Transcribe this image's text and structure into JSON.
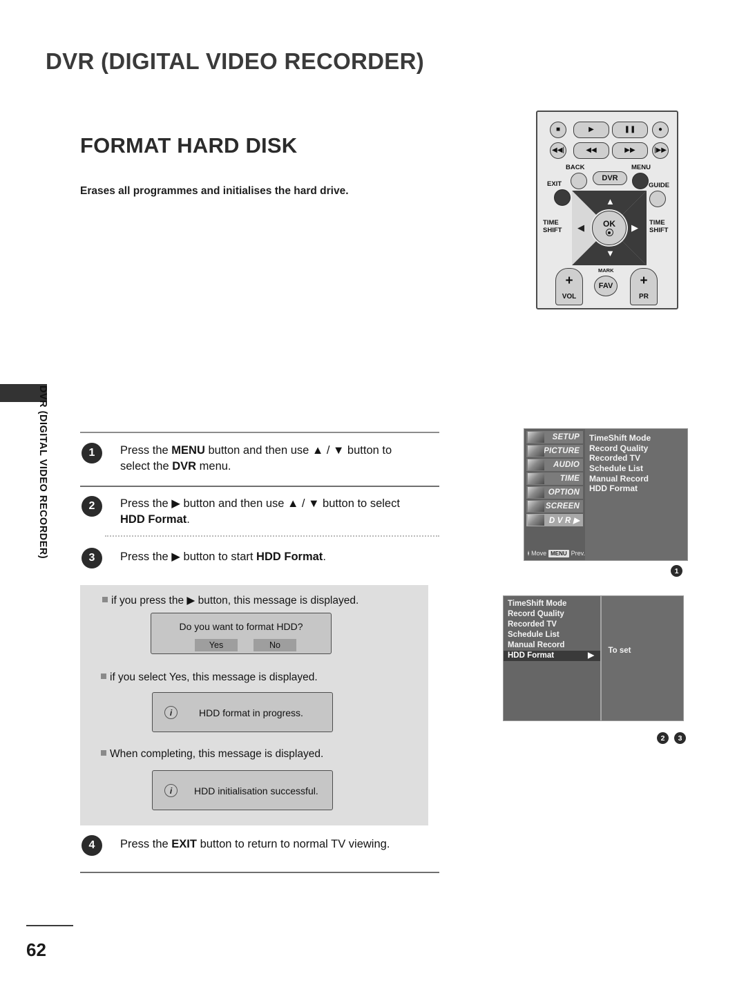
{
  "header": {
    "chapter_title": "DVR (DIGITAL VIDEO RECORDER)",
    "section_title": "FORMAT HARD DISK",
    "section_subtitle": "Erases all programmes and initialises the hard drive."
  },
  "sidebar": {
    "vertical_label": "DVR (DIGITAL VIDEO RECORDER)"
  },
  "remote": {
    "buttons": {
      "stop": "stop-icon",
      "play": "play-icon",
      "pause": "pause-icon",
      "record": "record-icon",
      "skip_back": "skip-back-icon",
      "rewind": "rewind-icon",
      "forward": "fast-forward-icon",
      "skip_forward": "skip-forward-icon"
    },
    "labels": {
      "back": "BACK",
      "dvr": "DVR",
      "menu": "MENU",
      "exit": "EXIT",
      "guide": "GUIDE",
      "time_shift_left_1": "TIME",
      "time_shift_left_2": "SHIFT",
      "time_shift_right_1": "TIME",
      "time_shift_right_2": "SHIFT",
      "ok": "OK",
      "vol_plus": "+",
      "vol": "VOL",
      "pr_plus": "+",
      "pr": "PR",
      "mark": "MARK",
      "fav": "FAV",
      "up_arrow": "▲",
      "down_arrow": "▼",
      "left_arrow": "◀",
      "right_arrow": "▶"
    }
  },
  "steps": [
    {
      "number": "1",
      "line1_a": "Press the ",
      "line1_b": "MENU",
      "line1_c": " button and  then use ▲ / ▼ button to",
      "line2_a": "select the ",
      "line2_b": "DVR",
      "line2_c": " menu."
    },
    {
      "number": "2",
      "line1_a": "Press the ▶ button and then use ▲ / ▼ button to select",
      "line2_b": "HDD Format",
      "line2_c": "."
    },
    {
      "number": "3",
      "line1_a": "Press the ▶ button to start ",
      "line1_b": "HDD Format",
      "line1_c": "."
    },
    {
      "number": "4",
      "line1_a": "Press the ",
      "line1_b": "EXIT",
      "line1_c": " button to return to normal TV viewing."
    }
  ],
  "notes": [
    "if you press the ▶ button, this message is displayed.",
    "if you select Yes, this message is displayed.",
    "When completing, this message is displayed."
  ],
  "dialogs": {
    "confirm": {
      "title": "Do you want to format HDD?",
      "yes": "Yes",
      "no": "No"
    },
    "progress": {
      "icon": "info-icon",
      "text": "HDD format in progress."
    },
    "success": {
      "icon": "info-icon",
      "text": "HDD initialisation successful."
    }
  },
  "osd_main": {
    "categories": [
      {
        "label": "SETUP",
        "selected": false
      },
      {
        "label": "PICTURE",
        "selected": false
      },
      {
        "label": "AUDIO",
        "selected": false
      },
      {
        "label": "TIME",
        "selected": false
      },
      {
        "label": "OPTION",
        "selected": false
      },
      {
        "label": "SCREEN",
        "selected": false
      },
      {
        "label": "D V R ▶",
        "selected": true
      }
    ],
    "items": [
      "TimeShift Mode",
      "Record Quality",
      "Recorded TV",
      "Schedule List",
      "Manual Record",
      "HDD Format"
    ],
    "status_move": "Move",
    "status_menu_chip": "MENU",
    "status_prev": "Prev.",
    "marker": "1"
  },
  "osd_submenu": {
    "items": [
      {
        "label": "TimeShift Mode",
        "selected": false,
        "arrow": ""
      },
      {
        "label": "Record Quality",
        "selected": false,
        "arrow": ""
      },
      {
        "label": "Recorded TV",
        "selected": false,
        "arrow": ""
      },
      {
        "label": "Schedule List",
        "selected": false,
        "arrow": ""
      },
      {
        "label": "Manual Record",
        "selected": false,
        "arrow": ""
      },
      {
        "label": "HDD Format",
        "selected": true,
        "arrow": "▶"
      }
    ],
    "right_panel_text": "To set",
    "marker_a": "2",
    "marker_b": "3"
  },
  "footer": {
    "page_number": "62"
  },
  "colors": {
    "panel_grey": "#dedede",
    "osd_grey": "#6d6d6d",
    "accent_dark": "#2b2b2b"
  }
}
